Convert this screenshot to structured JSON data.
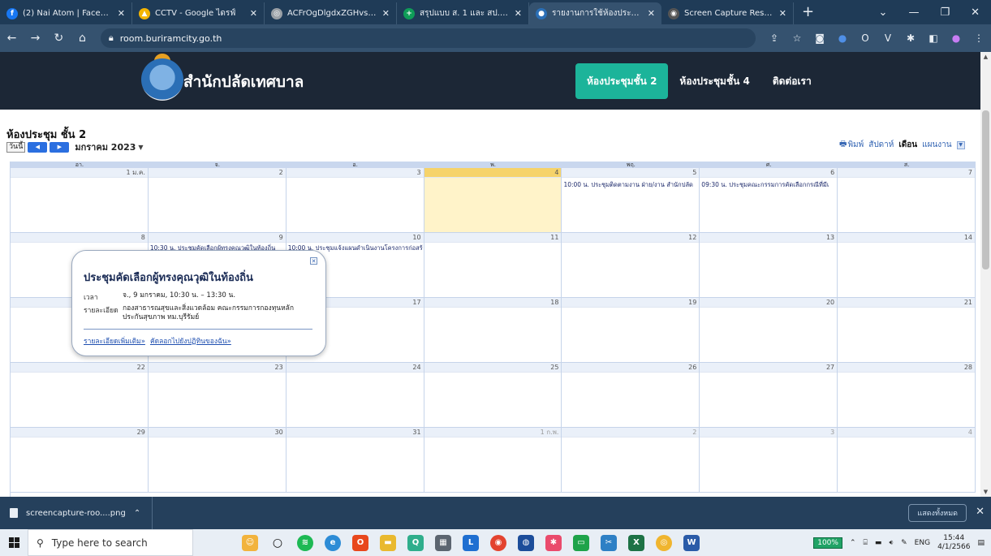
{
  "browser": {
    "tabs": [
      {
        "title": "(2) Nai Atom | Facebook",
        "icon": "facebook-icon",
        "color": "#1877f2",
        "glyph": "f"
      },
      {
        "title": "CCTV - Google ไดรฟ์",
        "icon": "google-drive-icon",
        "color": "#f4b400",
        "glyph": "▲"
      },
      {
        "title": "ACFrOgDlgdxZGHvs4aiLyH",
        "icon": "web-icon",
        "color": "#9aa0a6",
        "glyph": "◎"
      },
      {
        "title": "สรุปแบบ ส. 1 และ สป.2 ทุกกอง",
        "icon": "sheets-icon",
        "color": "#0f9d58",
        "glyph": "+"
      },
      {
        "title": "รายงานการใช้ห้องประชุม เทศบาล",
        "icon": "site-logo-icon",
        "color": "#2b6fb6",
        "glyph": "●",
        "active": true
      },
      {
        "title": "Screen Capture Result",
        "icon": "camera-icon",
        "color": "#555555",
        "glyph": "◉"
      }
    ],
    "new_tab": "+",
    "url": "room.buriramcity.go.th"
  },
  "site": {
    "name": "สำนักปลัดเทศบาล",
    "nav": [
      {
        "label": "ห้องประชุมชั้น 2",
        "active": true
      },
      {
        "label": "ห้องประชุมชั้น 4",
        "active": false
      },
      {
        "label": "ติดต่อเรา",
        "active": false
      }
    ]
  },
  "calendar": {
    "room_title": "ห้องประชุม ชั้น 2",
    "today_label": "วันนี้",
    "month_label": "มกราคม 2023",
    "print_label": "พิมพ์",
    "views": {
      "week": "สัปดาห์",
      "month": "เดือน",
      "agenda": "แผนงาน"
    },
    "weekdays": [
      "อา.",
      "จ.",
      "อ.",
      "พ.",
      "พฤ.",
      "ศ.",
      "ส."
    ],
    "weeks": [
      {
        "days": [
          "1 ม.ค.",
          "2",
          "3",
          "4",
          "5",
          "6",
          "7"
        ]
      },
      {
        "days": [
          "8",
          "9",
          "10",
          "11",
          "12",
          "13",
          "14"
        ]
      },
      {
        "days": [
          "15",
          "16",
          "17",
          "18",
          "19",
          "20",
          "21"
        ]
      },
      {
        "days": [
          "22",
          "23",
          "24",
          "25",
          "26",
          "27",
          "28"
        ]
      },
      {
        "days": [
          "29",
          "30",
          "31",
          "1 ก.พ.",
          "2",
          "3",
          "4"
        ]
      }
    ],
    "events": {
      "thu5": "10:00 น. ประชุมติดตามงาน ฝ่าย/งาน สำนักปลัด",
      "fri6": "09:30 น. ประชุมคณะกรรมการคัดเลือกกรณีที่มีเ",
      "mon9": "10:30 น. ประชุมคัดเลือกผู้ทรงคุณวุฒิในท้องถิ่น",
      "tue10": "10:00 น. ประชุมแจ้งแผนดำเนินงานโครงการก่อสร้"
    }
  },
  "popup": {
    "title": "ประชุมคัดเลือกผู้ทรงคุณวุฒิในท้องถิ่น",
    "time_label": "เวลา",
    "time_value": "จ., 9 มกราคม, 10:30 น. – 13:30 น.",
    "detail_label": "รายละเอียด",
    "detail_value": "กองสาธารณสุขและสิ่งแวดล้อม คณะกรรมการกองทุนหลักประกันสุขภาพ ทม.บุรีรัมย์",
    "link_more": "รายละเอียดเพิ่มเติม»",
    "link_copy": "คัดลอกไปยังปฏิทินของฉัน»"
  },
  "downloads": {
    "file": "screencapture-roo....png",
    "show_all": "แสดงทั้งหมด"
  },
  "taskbar": {
    "search_placeholder": "Type here to search",
    "zoom": "100%",
    "lang": "ENG",
    "time": "15:44",
    "date": "4/1/2566"
  }
}
